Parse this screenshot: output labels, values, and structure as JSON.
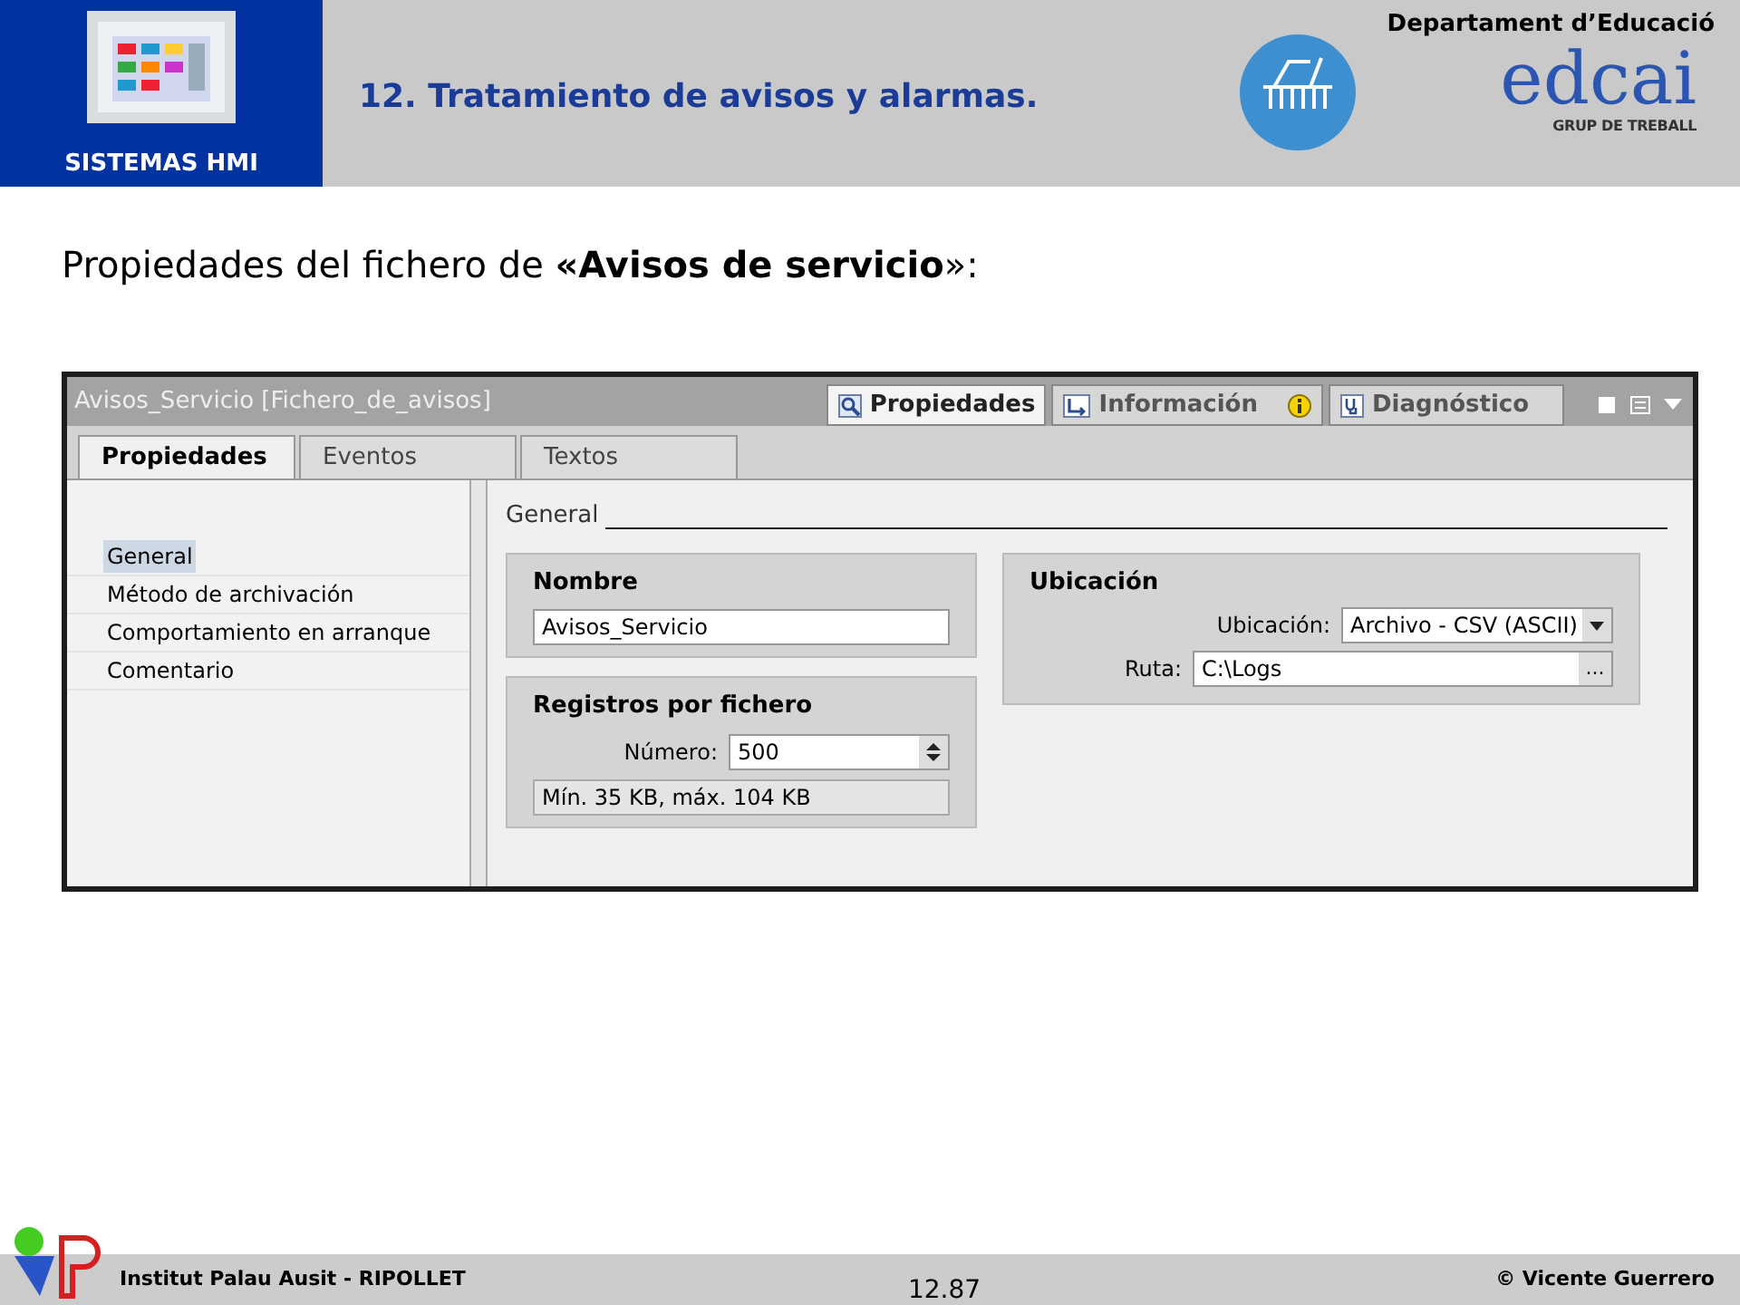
{
  "header": {
    "section": "SISTEMAS HMI",
    "title": "12. Tratamiento de avisos y alarmas.",
    "department": "Departament d’Educació",
    "logo_text": "edcai",
    "logo_subtext": "GRUP DE TREBALL"
  },
  "heading": "Propiedades del fichero de **«Avisos de servicio**»:",
  "panel": {
    "title": "Avisos_Servicio [Fichero_de_avisos]",
    "view_tabs": [
      {
        "label": "Propiedades",
        "selected": true,
        "kind": "properties"
      },
      {
        "label": "Información",
        "selected": false,
        "kind": "info"
      },
      {
        "label": "Diagnóstico",
        "selected": false,
        "kind": "diagnostics"
      }
    ],
    "tabs": [
      {
        "label": "Propiedades",
        "selected": true
      },
      {
        "label": "Eventos",
        "selected": false
      },
      {
        "label": "Textos",
        "selected": false
      }
    ],
    "nav": [
      {
        "label": "General",
        "selected": true
      },
      {
        "label": "Método de archivación",
        "selected": false
      },
      {
        "label": "Comportamiento en arranque",
        "selected": false
      },
      {
        "label": "Comentario",
        "selected": false
      }
    ],
    "section": "General",
    "nombre": {
      "title": "Nombre",
      "value": "Avisos_Servicio"
    },
    "registros": {
      "title": "Registros por fichero",
      "label": "Número:",
      "value": "500",
      "note": "Mín. 35 KB, máx. 104 KB"
    },
    "ubicacion": {
      "title": "Ubicación",
      "type_label": "Ubicación:",
      "type_value": "Archivo - CSV (ASCII)",
      "path_label": "Ruta:",
      "path_value": "C:\\Logs",
      "browse": "..."
    }
  },
  "footer": {
    "institute": "Institut Palau Ausit - RIPOLLET",
    "page": "12.87",
    "copyright": "© Vicente Guerrero"
  }
}
